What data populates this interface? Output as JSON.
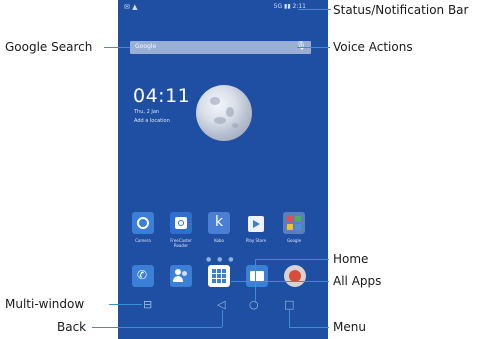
{
  "callouts": {
    "status_bar": "Status/Notification Bar",
    "google_search": "Google Search",
    "voice_actions": "Voice Actions",
    "home": "Home",
    "all_apps": "All Apps",
    "multi_window": "Multi-window",
    "back": "Back",
    "menu": "Menu"
  },
  "phone": {
    "status_left": "✉ ▲",
    "status_right": "5G ▮▮ 2:11",
    "search_placeholder": "Google",
    "clock": "04:11",
    "date": "Thu, 2 Jan",
    "add_location": "Add a location",
    "apps": [
      {
        "label": "Camera",
        "icon": "camera-icon",
        "color": "#3b7fd6",
        "glyph": "◉"
      },
      {
        "label": "FreeCaster Reader",
        "icon": "reader-icon",
        "color": "#2f6fcf",
        "glyph": "⟳"
      },
      {
        "label": "Kobo",
        "icon": "kobo-icon",
        "color": "#4a7fd3",
        "glyph": "k"
      },
      {
        "label": "Play Store",
        "icon": "play-store-icon",
        "color": "#e9eef7",
        "glyph": "▶"
      },
      {
        "label": "Google",
        "icon": "google-folder-icon",
        "color": "#5a7fbf",
        "glyph": "▦"
      }
    ],
    "dock": [
      {
        "icon": "phone-icon",
        "color": "#3b7fd6",
        "glyph": "✆"
      },
      {
        "icon": "contacts-icon",
        "color": "#3b7fd6",
        "glyph": "👥"
      },
      {
        "icon": "all-apps-icon",
        "color": "#ffffff",
        "glyph": "▦"
      },
      {
        "icon": "messages-icon",
        "color": "#3b7fd6",
        "glyph": "✉"
      },
      {
        "icon": "browser-icon",
        "color": "#d94b3a",
        "glyph": "◍"
      }
    ],
    "nav": {
      "multi_window": "⊟",
      "back": "◁",
      "home": "○",
      "menu": "□"
    }
  }
}
